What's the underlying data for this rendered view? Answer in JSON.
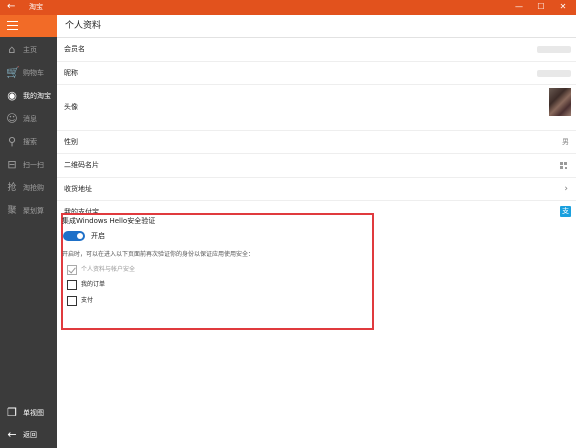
{
  "app": {
    "title": "淘宝",
    "back_glyph": "←",
    "window_buttons": [
      "—",
      "☐",
      "✕"
    ]
  },
  "accent_color": "#e2521d",
  "sidebar": {
    "items": [
      {
        "label": "主页",
        "icon": "home-icon",
        "glyph": "⌂"
      },
      {
        "label": "购物车",
        "icon": "cart-icon",
        "glyph": "🛒"
      },
      {
        "label": "我的淘宝",
        "icon": "user-icon",
        "glyph": "◉"
      },
      {
        "label": "消息",
        "icon": "message-icon",
        "glyph": "☺"
      },
      {
        "label": "搜索",
        "icon": "search-icon",
        "glyph": "⚲"
      },
      {
        "label": "扫一扫",
        "icon": "scan-icon",
        "glyph": "⊟"
      },
      {
        "label": "淘抢购",
        "icon": "flash-sale-icon",
        "glyph": "抢"
      },
      {
        "label": "聚划算",
        "icon": "group-buy-icon",
        "glyph": "聚"
      }
    ],
    "bottom": [
      {
        "label": "单视图",
        "icon": "single-view-icon",
        "glyph": "❐"
      },
      {
        "label": "返回",
        "icon": "back-icon",
        "glyph": "←"
      }
    ]
  },
  "page": {
    "title": "个人资料",
    "rows": [
      {
        "label": "会员名"
      },
      {
        "label": "昵称"
      },
      {
        "label": "头像"
      },
      {
        "label": "性别",
        "value": "男"
      },
      {
        "label": "二维码名片"
      },
      {
        "label": "收货地址",
        "chevron": "›"
      },
      {
        "label": "我的支付宝",
        "badge": "支"
      }
    ]
  },
  "hello": {
    "title": "集成Windows Hello安全验证",
    "toggle_label": "开启",
    "toggle_on": true,
    "hint": "开启时，可以在进入以下页面前再次验证你的身份以保证应用使用安全：",
    "options": [
      {
        "label": "个人资料与帐户安全",
        "checked": true,
        "disabled": true
      },
      {
        "label": "我的订单",
        "checked": false,
        "disabled": false
      },
      {
        "label": "支付",
        "checked": false,
        "disabled": false
      }
    ]
  }
}
